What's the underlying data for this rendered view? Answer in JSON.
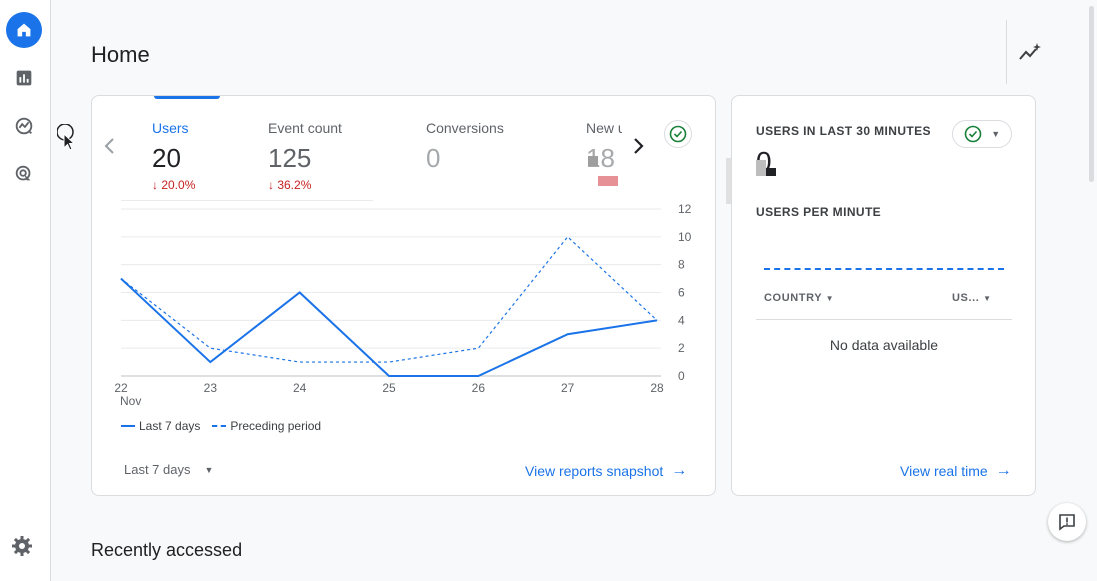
{
  "colors": {
    "accent": "#1a73e8",
    "negative": "#c5221f",
    "border": "#dadce0"
  },
  "rail": {
    "items": [
      {
        "name": "home",
        "icon": "home-icon",
        "active": true
      },
      {
        "name": "reports",
        "icon": "bar-chart-icon"
      },
      {
        "name": "explore",
        "icon": "explore-icon"
      },
      {
        "name": "advertising",
        "icon": "target-icon"
      }
    ],
    "settings_icon": "gear-icon"
  },
  "header": {
    "title": "Home",
    "insights_icon": "insights-sparkle-icon"
  },
  "overview": {
    "metrics": [
      {
        "label": "Users",
        "value": "20",
        "change": "↓ 20.0%",
        "selected": true
      },
      {
        "label": "Event count",
        "value": "125",
        "change": "↓ 36.2%"
      },
      {
        "label": "Conversions",
        "value": "0",
        "change": ""
      },
      {
        "label": "New u",
        "value": "18",
        "change": ""
      }
    ],
    "period_label": "Last 7 days",
    "link_label": "View reports snapshot",
    "legend": {
      "current": "Last 7 days",
      "previous": "Preceding period"
    }
  },
  "chart_data": {
    "type": "line",
    "x": [
      "22",
      "23",
      "24",
      "25",
      "26",
      "27",
      "28"
    ],
    "x_sublabel_first": "Nov",
    "series": [
      {
        "name": "Last 7 days",
        "style": "solid",
        "values": [
          7,
          1,
          6,
          0,
          0,
          3,
          4
        ]
      },
      {
        "name": "Preceding period",
        "style": "dashed",
        "values": [
          7,
          2,
          1,
          1,
          2,
          10,
          4
        ]
      }
    ],
    "y_ticks": [
      12,
      10,
      8,
      6,
      4,
      2,
      0
    ],
    "ylim": [
      0,
      12
    ],
    "grid": true
  },
  "realtime": {
    "title": "USERS IN LAST 30 MINUTES",
    "value": "0",
    "sub_title": "USERS PER MINUTE",
    "columns": [
      "COUNTRY",
      "US..."
    ],
    "empty_text": "No data available",
    "link_label": "View real time"
  },
  "recent": {
    "title": "Recently accessed"
  }
}
